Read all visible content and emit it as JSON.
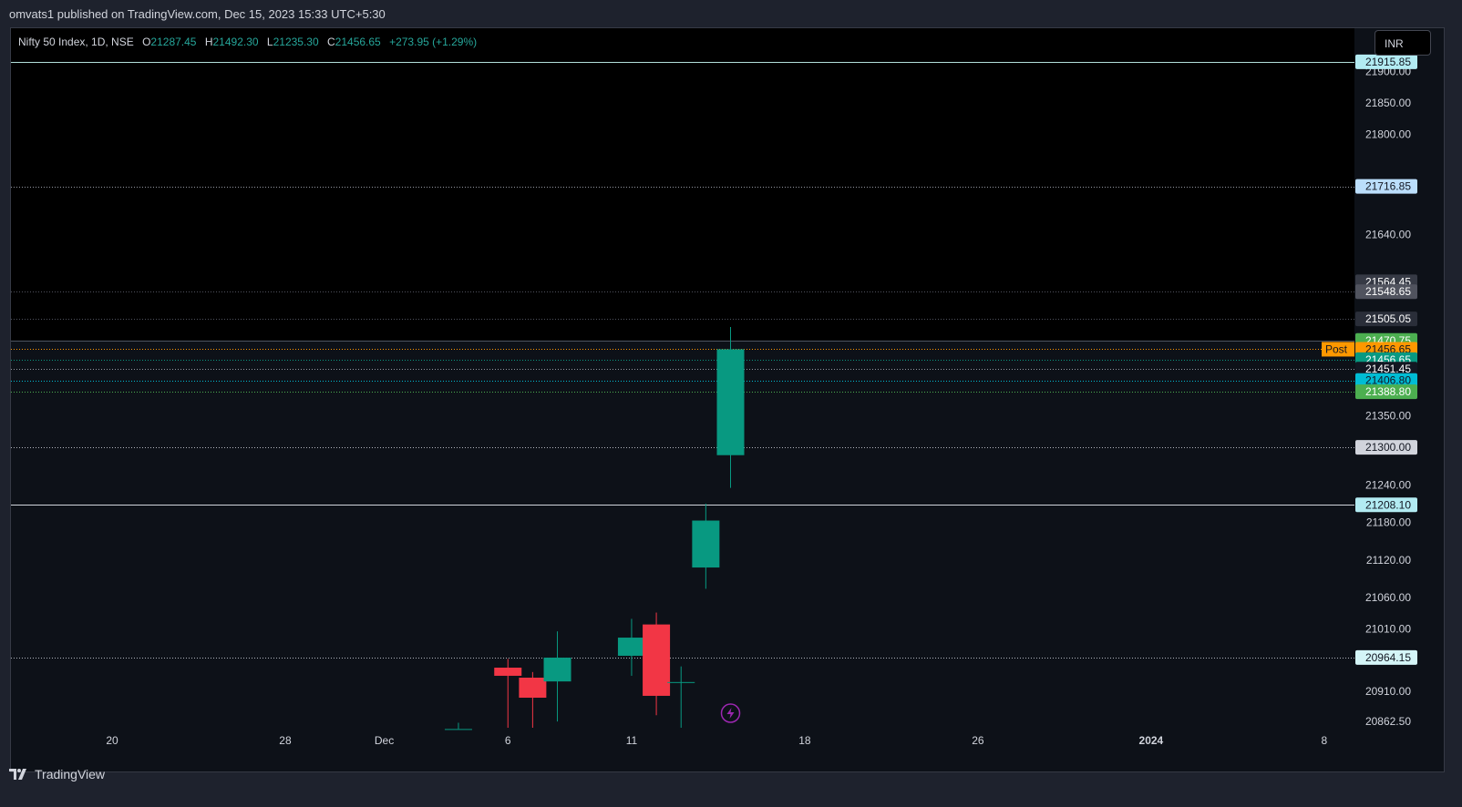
{
  "header": {
    "published": "omvats1 published on TradingView.com, Dec 15, 2023 15:33 UTC+5:30"
  },
  "legend": {
    "symbol": "Nifty 50 Index, 1D, NSE",
    "o_label": "O",
    "o_value": "21287.45",
    "h_label": "H",
    "h_value": "21492.30",
    "l_label": "L",
    "l_value": "21235.30",
    "c_label": "C",
    "c_value": "21456.65",
    "change": "+273.95 (+1.29%)"
  },
  "currency_button": "INR",
  "footer": {
    "brand": "TradingView"
  },
  "colors": {
    "up": "#089981",
    "down": "#f23645",
    "background": "#0d1118",
    "axis_text": "#d1d4dc"
  },
  "chart_data": {
    "type": "candlestick",
    "title": "Nifty 50 Index, 1D, NSE",
    "y_range": [
      20852,
      21920
    ],
    "x_tick_labels": [
      "20",
      "28",
      "Dec",
      "6",
      "11",
      "18",
      "26",
      "2024",
      "8"
    ],
    "y_tick_labels": [
      "21900.00",
      "21850.00",
      "21800.00",
      "21640.00",
      "21350.00",
      "21240.00",
      "21180.00",
      "21120.00",
      "21060.00",
      "21010.00",
      "20910.00",
      "20862.50"
    ],
    "candles": [
      {
        "date": "2023-12-04",
        "open": 20850,
        "high": 20860,
        "low": 20850,
        "close": 20850
      },
      {
        "date": "2023-12-06",
        "open": 20948,
        "high": 20962,
        "low": 20852,
        "close": 20935
      },
      {
        "date": "2023-12-07",
        "open": 20932,
        "high": 20941,
        "low": 20852,
        "close": 20900
      },
      {
        "date": "2023-12-08",
        "open": 20926,
        "high": 21006,
        "low": 20862,
        "close": 20964
      },
      {
        "date": "2023-12-11",
        "open": 20967,
        "high": 21026,
        "low": 20935,
        "close": 20996
      },
      {
        "date": "2023-12-12",
        "open": 21017,
        "high": 21036,
        "low": 20872,
        "close": 20903
      },
      {
        "date": "2023-12-13",
        "open": 20925,
        "high": 20950,
        "low": 20852,
        "close": 20925
      },
      {
        "date": "2023-12-14",
        "open": 21108,
        "high": 21210,
        "low": 21074,
        "close": 21183
      },
      {
        "date": "2023-12-15",
        "open": 21287.45,
        "high": 21492.3,
        "low": 21235.3,
        "close": 21456.65
      }
    ],
    "levels": [
      {
        "label": "21915.85",
        "value": 21915.85,
        "style": "solid",
        "line": "#b2dfdb",
        "tag_bg": "#b2ebf2",
        "tag_fg": "#131722"
      },
      {
        "label": "21716.85",
        "value": 21716.85,
        "style": "dotted",
        "line": "#9598a1",
        "tag_bg": "#bbdefb",
        "tag_fg": "#131722"
      },
      {
        "label": "21564.45",
        "value": 21564.45,
        "style": "none",
        "line": "#9598a1",
        "tag_bg": "#363a45",
        "tag_fg": "#ffffff"
      },
      {
        "label": "21548.65",
        "value": 21548.65,
        "style": "dotted",
        "line": "#50535e",
        "tag_bg": "#50535e",
        "tag_fg": "#ffffff"
      },
      {
        "label": "21505.05",
        "value": 21505.05,
        "style": "dotted",
        "line": "#50535e",
        "tag_bg": "#2a2e39",
        "tag_fg": "#ffffff"
      },
      {
        "label": "21470.75",
        "value": 21470.75,
        "style": "solid",
        "line": "#4c525e",
        "tag_bg": "#4caf50",
        "tag_fg": "#ffffff"
      },
      {
        "label": "21456.65",
        "value": 21456.65,
        "style": "dotted",
        "line": "#ff9800",
        "tag_bg": "#ff9800",
        "tag_fg": "#131722",
        "prefix": "Post"
      },
      {
        "label": "21456.65",
        "value": 21440,
        "style": "dotted",
        "line": "#089981",
        "tag_bg": "#089981",
        "tag_fg": "#ffffff"
      },
      {
        "label": "21451.45",
        "value": 21425,
        "style": "dotted",
        "line": "#9598a1",
        "tag_bg": "#131722",
        "tag_fg": "#ffffff"
      },
      {
        "label": "21406.80",
        "value": 21406.8,
        "style": "dotted",
        "line": "#00bcd4",
        "tag_bg": "#00bcd4",
        "tag_fg": "#131722"
      },
      {
        "label": "21388.80",
        "value": 21388.8,
        "style": "dotted",
        "line": "#4caf50",
        "tag_bg": "#4caf50",
        "tag_fg": "#ffffff"
      },
      {
        "label": "21300.00",
        "value": 21300.0,
        "style": "dotted",
        "line": "#b2b5be",
        "tag_bg": "#d1d4dc",
        "tag_fg": "#131722"
      },
      {
        "label": "21208.10",
        "value": 21208.1,
        "style": "solid",
        "line": "#d1d4dc",
        "tag_bg": "#b2ebf2",
        "tag_fg": "#131722"
      },
      {
        "label": "20964.15",
        "value": 20964.15,
        "style": "dotted",
        "line": "#b2b5be",
        "tag_bg": "#d4f5f7",
        "tag_fg": "#131722"
      }
    ],
    "annotations": [
      {
        "type": "flash-icon",
        "date": "2023-12-15"
      }
    ]
  }
}
